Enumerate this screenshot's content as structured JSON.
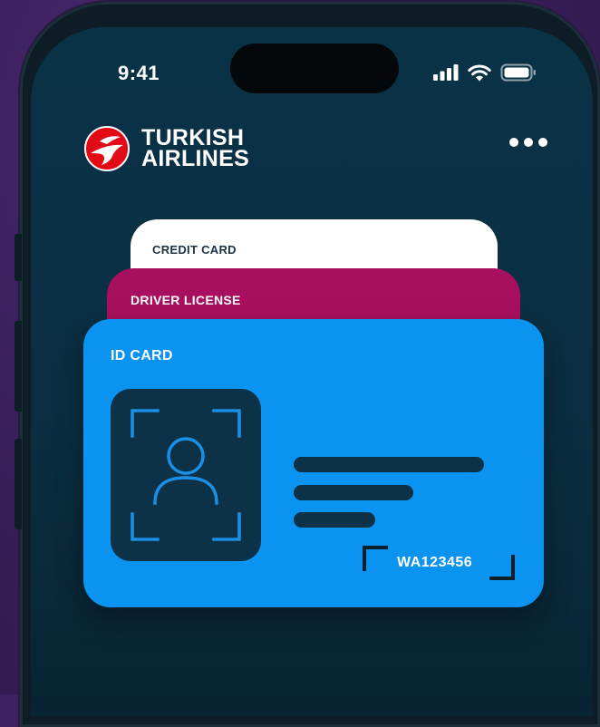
{
  "status_bar": {
    "time": "9:41",
    "icons": [
      "signal-bars-icon",
      "wifi-icon",
      "battery-icon"
    ]
  },
  "header": {
    "brand_line1": "TURKISH",
    "brand_line2": "AIRLINES",
    "logo_icon": "turkish-airlines-logo",
    "more_icon": "more-dots-icon"
  },
  "cards": {
    "credit_card": {
      "label": "CREDIT CARD",
      "color": "#ffffff"
    },
    "driver_license": {
      "label": "DRIVER LICENSE",
      "color": "#a80f5f"
    },
    "id_card": {
      "label": "ID CARD",
      "color": "#0a93f1",
      "document_number": "WA123456",
      "photo_icon": "person-scan-icon"
    }
  },
  "colors": {
    "background": "#3a1f5c",
    "screen": "#0b2e42",
    "brand_red": "#e30a17"
  }
}
